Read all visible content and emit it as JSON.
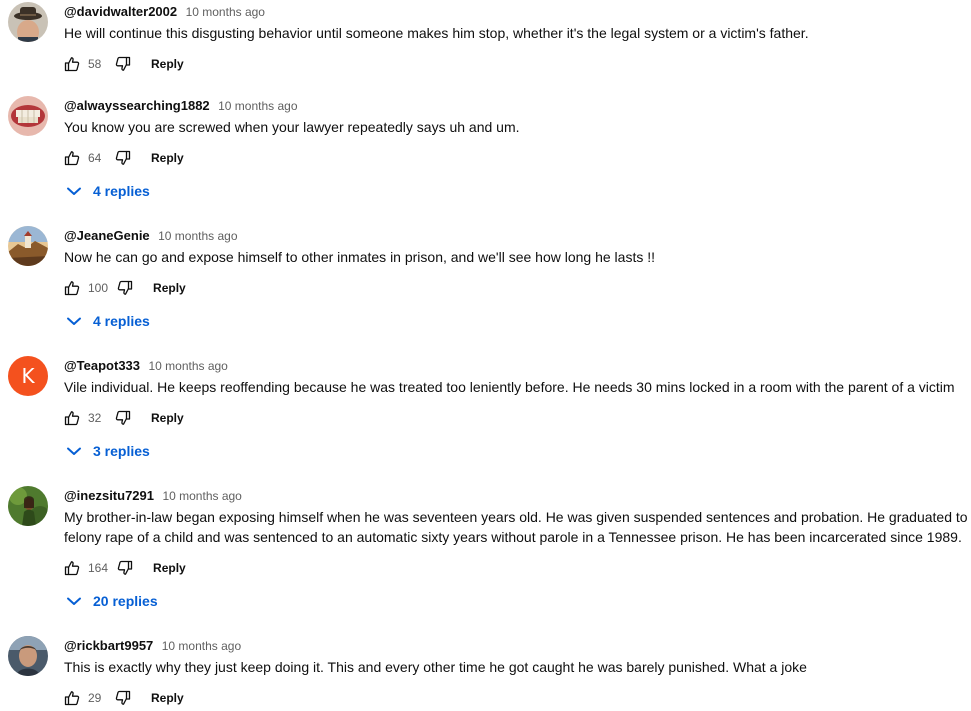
{
  "comments": [
    {
      "author": "@davidwalter2002",
      "time": "10 months ago",
      "text": "He will continue this disgusting behavior until someone makes him stop, whether it's the legal system or a victim's father.",
      "likes": "58",
      "reply_label": "Reply",
      "avatar": "man-with-hat-photo"
    },
    {
      "author": "@alwayssearching1882",
      "time": "10 months ago",
      "text": "You know you are screwed when your lawyer repeatedly says uh and um.",
      "likes": "64",
      "reply_label": "Reply",
      "replies_label": "4 replies",
      "avatar": "teeth-photo"
    },
    {
      "author": "@JeaneGenie",
      "time": "10 months ago",
      "text": "Now he can go and expose himself to other inmates in prison, and we'll see how long he lasts !!",
      "likes": "100",
      "reply_label": "Reply",
      "replies_label": "4 replies",
      "avatar": "castle-landscape-photo"
    },
    {
      "author": "@Teapot333",
      "time": "10 months ago",
      "text": "Vile individual. He keeps reoffending because he was treated too leniently before. He needs 30 mins locked in a room with the parent of a victim",
      "likes": "32",
      "reply_label": "Reply",
      "replies_label": "3 replies",
      "avatar_letter": "K",
      "avatar_color": "#f4511e"
    },
    {
      "author": "@inezsitu7291",
      "time": "10 months ago",
      "text": "My brother-in-law began exposing himself when he was seventeen years old. He was given suspended sentences and probation. He graduated to felony rape of a child and was sentenced to an automatic sixty years without parole in a Tennessee prison. He has been incarcerated since 1989.",
      "likes": "164",
      "reply_label": "Reply",
      "replies_label": "20 replies",
      "avatar": "green-nature-photo"
    },
    {
      "author": "@rickbart9957",
      "time": "10 months ago",
      "text": "This is exactly why they just keep doing it. This and every other time he got caught he was barely punished. What a joke",
      "likes": "29",
      "reply_label": "Reply",
      "avatar": "man-portrait-photo"
    }
  ],
  "colors": {
    "link_blue": "#065fd4",
    "meta_gray": "#606060",
    "text": "#0f0f0f"
  },
  "icons": {
    "like": "thumbs-up-icon",
    "dislike": "thumbs-down-icon",
    "expand": "chevron-down-icon"
  }
}
